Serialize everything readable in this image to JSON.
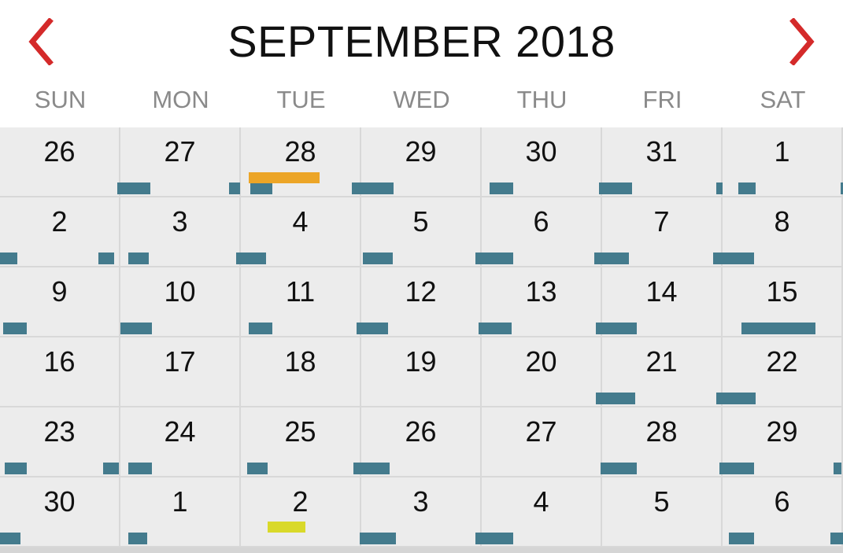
{
  "header": {
    "title": "SEPTEMBER 2018",
    "prev_icon": "chevron-left-icon",
    "next_icon": "chevron-right-icon",
    "accent_color": "#d42a2a"
  },
  "weekdays": [
    "SUN",
    "MON",
    "TUE",
    "WED",
    "THU",
    "FRI",
    "SAT"
  ],
  "weeks": [
    [
      "26",
      "27",
      "28",
      "29",
      "30",
      "31",
      "1"
    ],
    [
      "2",
      "3",
      "4",
      "5",
      "6",
      "7",
      "8"
    ],
    [
      "9",
      "10",
      "11",
      "12",
      "13",
      "14",
      "15"
    ],
    [
      "16",
      "17",
      "18",
      "19",
      "20",
      "21",
      "22"
    ],
    [
      "23",
      "24",
      "25",
      "26",
      "27",
      "28",
      "29"
    ],
    [
      "30",
      "1",
      "2",
      "3",
      "4",
      "5",
      "6"
    ]
  ],
  "colors": {
    "event_bar": "#447b8d",
    "marker_orange": "#eca527",
    "marker_yellow": "#d9d92a"
  }
}
